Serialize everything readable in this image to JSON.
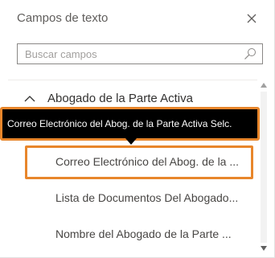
{
  "panel": {
    "title": "Campos de texto"
  },
  "search": {
    "placeholder": "Buscar campos",
    "value": ""
  },
  "icons": {
    "close": "close-icon",
    "search": "search-icon",
    "group_toggle": "chevron-up-icon"
  },
  "group": {
    "label": "Abogado de la Parte Activa",
    "expanded": true
  },
  "tooltip": {
    "text": "Correo Electrónico del Abog. de la Parte Activa Selc."
  },
  "fields": [
    {
      "label": "Correo Electrónico del Abog. de la ...",
      "selected": true
    },
    {
      "label": "Lista de Documentos Del Abogado...",
      "selected": false
    },
    {
      "label": "Nombre del Abogado de la Parte ...",
      "selected": false
    }
  ],
  "colors": {
    "highlight": "#e8862b",
    "tooltip_bg": "#000000"
  }
}
